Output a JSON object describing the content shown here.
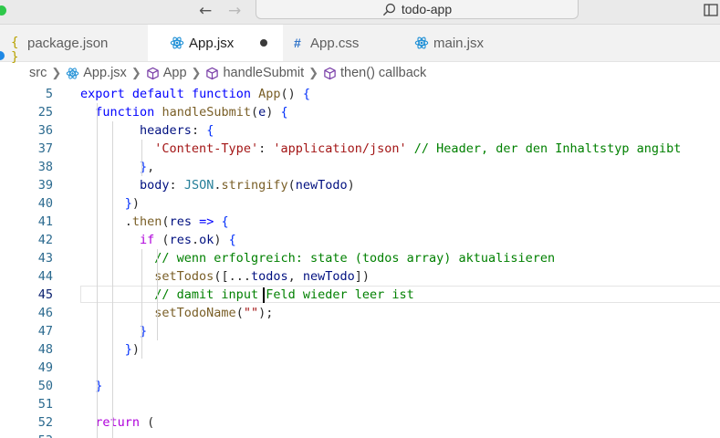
{
  "window": {
    "title": "todo-app",
    "accent": "#1e88e5"
  },
  "nav": {
    "back": "←",
    "forward": "→"
  },
  "tabs": [
    {
      "label": "package.json",
      "icon": "json-braces-icon",
      "active": false
    },
    {
      "label": "App.jsx",
      "icon": "react-icon",
      "active": true,
      "modified": true
    },
    {
      "label": "App.css",
      "icon": "css-hash-icon",
      "active": false
    },
    {
      "label": "main.jsx",
      "icon": "react-icon",
      "active": false
    }
  ],
  "breadcrumb": [
    {
      "label": "src",
      "icon": ""
    },
    {
      "label": "App.jsx",
      "icon": "react-icon"
    },
    {
      "label": "App",
      "icon": "symbol-cube-icon"
    },
    {
      "label": "handleSubmit",
      "icon": "symbol-cube-icon"
    },
    {
      "label": "then() callback",
      "icon": "symbol-cube-icon"
    }
  ],
  "editor": {
    "current_line": "45",
    "lines": [
      {
        "n": "5",
        "t": "export default function App() {"
      },
      {
        "n": "25",
        "t": "  function handleSubmit(e) {"
      },
      {
        "n": "36",
        "t": "        headers: {"
      },
      {
        "n": "37",
        "t": "          'Content-Type': 'application/json' // Header, der den Inhaltstyp angibt"
      },
      {
        "n": "38",
        "t": "        },"
      },
      {
        "n": "39",
        "t": "        body: JSON.stringify(newTodo)"
      },
      {
        "n": "40",
        "t": "      })"
      },
      {
        "n": "41",
        "t": "      .then(res => {"
      },
      {
        "n": "42",
        "t": "        if (res.ok) {"
      },
      {
        "n": "43",
        "t": "          // wenn erfolgreich: state (todos array) aktualisieren"
      },
      {
        "n": "44",
        "t": "          setTodos([...todos, newTodo])"
      },
      {
        "n": "45",
        "t": "          // damit input Feld wieder leer ist"
      },
      {
        "n": "46",
        "t": "          setTodoName(\"\");"
      },
      {
        "n": "47",
        "t": "        }"
      },
      {
        "n": "48",
        "t": "      })"
      },
      {
        "n": "49",
        "t": ""
      },
      {
        "n": "50",
        "t": "  }"
      },
      {
        "n": "51",
        "t": ""
      },
      {
        "n": "52",
        "t": "  return ("
      },
      {
        "n": "53",
        "t": ""
      }
    ]
  }
}
